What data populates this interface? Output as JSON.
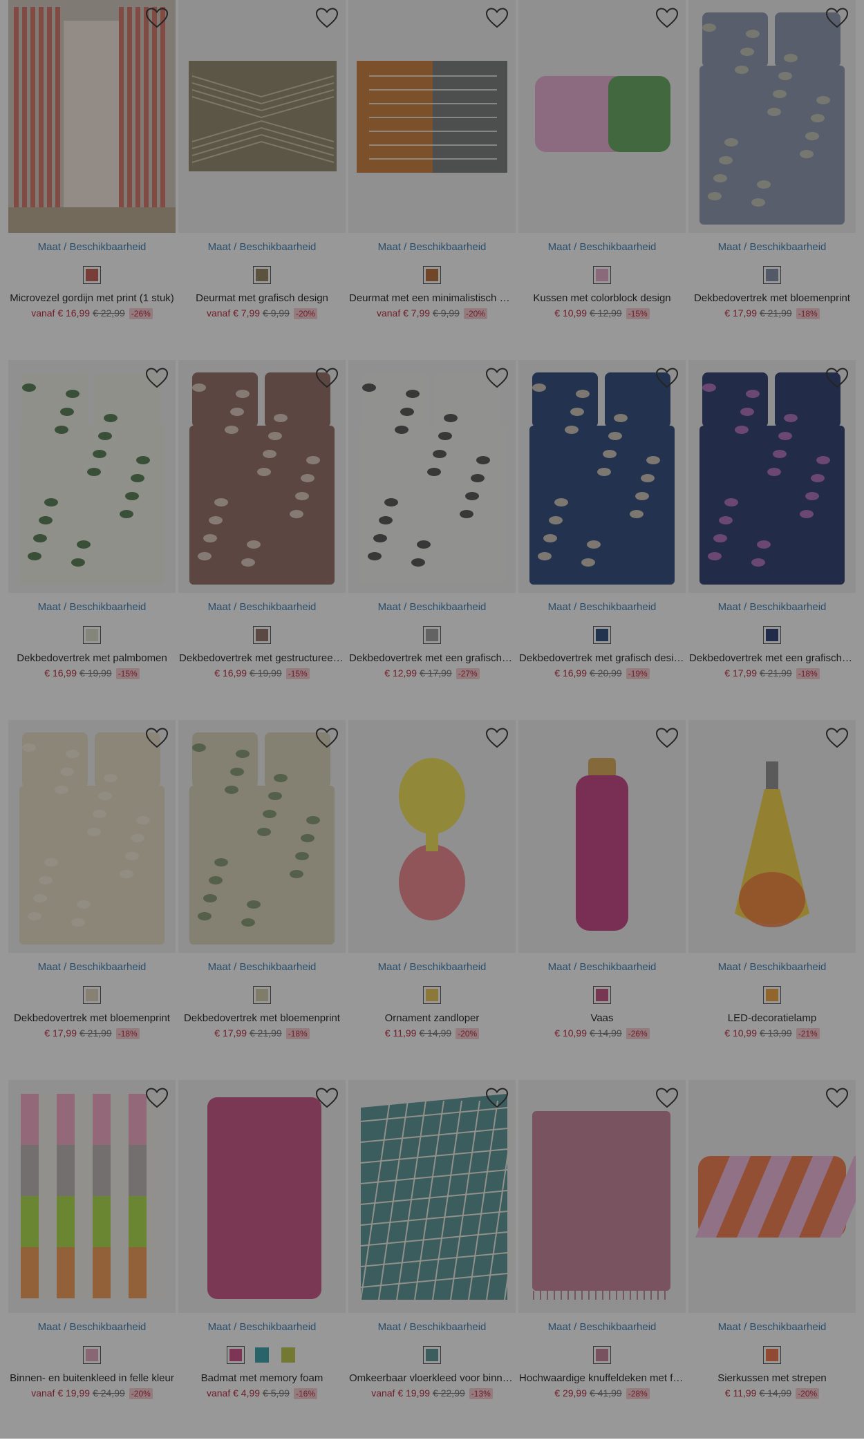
{
  "availability_label": "Maat / Beschikbaarheid",
  "products": [
    {
      "name": "Microvezel gordijn met print (1 stuk)",
      "prefix": "vanaf",
      "price": "€ 16,99",
      "old_price": "€ 22,99",
      "discount": "-26%",
      "image": "curtain",
      "swatches": [
        {
          "color": "#c0514a",
          "selected": true
        }
      ],
      "colors": [
        "#d36a5a",
        "#f3e7dc",
        "#b9a88a"
      ]
    },
    {
      "name": "Deurmat met grafisch design",
      "prefix": "vanaf",
      "price": "€ 7,99",
      "old_price": "€ 9,99",
      "discount": "-20%",
      "image": "mat-zigzag",
      "swatches": [
        {
          "color": "#8a7a55",
          "selected": true
        }
      ],
      "colors": [
        "#8c8163",
        "#c9c0a4"
      ]
    },
    {
      "name": "Deurmat met een minimalistisch design",
      "prefix": "vanaf",
      "price": "€ 7,99",
      "old_price": "€ 9,99",
      "discount": "-20%",
      "image": "mat-split",
      "swatches": [
        {
          "color": "#b0642a",
          "selected": true
        }
      ],
      "colors": [
        "#c7762c",
        "#6f7372",
        "#ffffff"
      ]
    },
    {
      "name": "Kussen met colorblock design",
      "prefix": "",
      "price": "€ 10,99",
      "old_price": "€ 12,99",
      "discount": "-15%",
      "image": "pillow-block",
      "swatches": [
        {
          "color": "#e4a5c8",
          "selected": true
        }
      ],
      "colors": [
        "#e8a7cf",
        "#5aa456"
      ]
    },
    {
      "name": "Dekbedovertrek met bloemenprint",
      "prefix": "",
      "price": "€ 17,99",
      "old_price": "€ 21,99",
      "discount": "-18%",
      "image": "bed",
      "swatches": [
        {
          "color": "#7d86a3",
          "selected": true
        }
      ],
      "colors": [
        "#8790ad",
        "#c9cbb4"
      ]
    },
    {
      "name": "Dekbedovertrek met palmbomen",
      "prefix": "",
      "price": "€ 16,99",
      "old_price": "€ 19,99",
      "discount": "-15%",
      "image": "bed",
      "swatches": [
        {
          "color": "#d9dcc8",
          "selected": true
        }
      ],
      "colors": [
        "#eef0e4",
        "#2f5e2b"
      ]
    },
    {
      "name": "Dekbedovertrek met gestructureerde print",
      "prefix": "",
      "price": "€ 16,99",
      "old_price": "€ 19,99",
      "discount": "-15%",
      "image": "bed",
      "swatches": [
        {
          "color": "#8a6a5e",
          "selected": true
        }
      ],
      "colors": [
        "#8c6358",
        "#ead8cb"
      ]
    },
    {
      "name": "Dekbedovertrek met een grafische print",
      "prefix": "",
      "price": "€ 12,99",
      "old_price": "€ 17,99",
      "discount": "-27%",
      "image": "bed",
      "swatches": [
        {
          "color": "#9a9a9a",
          "selected": true
        }
      ],
      "colors": [
        "#f2f1ed",
        "#2a2a2a"
      ]
    },
    {
      "name": "Dekbedovertrek met grafisch design",
      "prefix": "",
      "price": "€ 16,99",
      "old_price": "€ 20,99",
      "discount": "-19%",
      "image": "bed",
      "swatches": [
        {
          "color": "#1e3f76",
          "selected": true
        }
      ],
      "colors": [
        "#1f3d73",
        "#e9d7bd"
      ]
    },
    {
      "name": "Dekbedovertrek met een grafisch design",
      "prefix": "",
      "price": "€ 17,99",
      "old_price": "€ 21,99",
      "discount": "-18%",
      "image": "bed",
      "swatches": [
        {
          "color": "#1b2f6a",
          "selected": true
        }
      ],
      "colors": [
        "#1d2e66",
        "#c36ec8"
      ]
    },
    {
      "name": "Dekbedovertrek met bloemenprint",
      "prefix": "",
      "price": "€ 17,99",
      "old_price": "€ 21,99",
      "discount": "-18%",
      "image": "bed",
      "swatches": [
        {
          "color": "#ddd3ba",
          "selected": true
        }
      ],
      "colors": [
        "#e6dcc2",
        "#f4ecd8"
      ]
    },
    {
      "name": "Dekbedovertrek met bloemenprint",
      "prefix": "",
      "price": "€ 17,99",
      "old_price": "€ 21,99",
      "discount": "-18%",
      "image": "bed",
      "swatches": [
        {
          "color": "#cfc9a8",
          "selected": true
        }
      ],
      "colors": [
        "#d9d4b7",
        "#6c8a5c"
      ]
    },
    {
      "name": "Ornament zandloper",
      "prefix": "",
      "price": "€ 11,99",
      "old_price": "€ 14,99",
      "discount": "-20%",
      "image": "hourglass",
      "swatches": [
        {
          "color": "#e9c24a",
          "selected": true
        }
      ],
      "colors": [
        "#f1e14a",
        "#f07f86"
      ]
    },
    {
      "name": "Vaas",
      "prefix": "",
      "price": "€ 10,99",
      "old_price": "€ 14,99",
      "discount": "-26%",
      "image": "vase",
      "swatches": [
        {
          "color": "#c0447a",
          "selected": true
        }
      ],
      "colors": [
        "#c4357b",
        "#d9a54b"
      ]
    },
    {
      "name": "LED-decoratielamp",
      "prefix": "",
      "price": "€ 10,99",
      "old_price": "€ 13,99",
      "discount": "-21%",
      "image": "bottle-lamp",
      "swatches": [
        {
          "color": "#f0a030",
          "selected": true
        }
      ],
      "colors": [
        "#f7d23a",
        "#f56a2a"
      ]
    },
    {
      "name": "Binnen- en buitenkleed in felle kleur",
      "prefix": "vanaf",
      "price": "€ 19,99",
      "old_price": "€ 24,99",
      "discount": "-20%",
      "image": "rug-stripes",
      "swatches": [
        {
          "color": "#e0a0b8",
          "selected": true
        }
      ],
      "colors": [
        "#f5a6c4",
        "#b8b0ae",
        "#a9dc3c",
        "#f6964a",
        "#f3efe8"
      ]
    },
    {
      "name": "Badmat met memory foam",
      "prefix": "vanaf",
      "price": "€ 4,99",
      "old_price": "€ 5,99",
      "discount": "-16%",
      "image": "bathmat",
      "swatches": [
        {
          "color": "#c9417f",
          "selected": true
        },
        {
          "color": "#2a9ba8",
          "selected": false
        },
        {
          "color": "#b8c23e",
          "selected": false
        }
      ],
      "colors": [
        "#c5477e"
      ]
    },
    {
      "name": "Omkeerbaar vloerkleed voor binnen en buiten",
      "prefix": "vanaf",
      "price": "€ 19,99",
      "old_price": "€ 22,99",
      "discount": "-13%",
      "image": "rug-grid",
      "swatches": [
        {
          "color": "#4f8f91",
          "selected": true
        }
      ],
      "colors": [
        "#4e8e91",
        "#f2efe6"
      ]
    },
    {
      "name": "Hochwaardige knuffeldeken met franjes",
      "prefix": "",
      "price": "€ 29,99",
      "old_price": "€ 41,99",
      "discount": "-28%",
      "image": "throw",
      "swatches": [
        {
          "color": "#c27a92",
          "selected": true
        }
      ],
      "colors": [
        "#c67b94"
      ]
    },
    {
      "name": "Sierkussen met strepen",
      "prefix": "",
      "price": "€ 11,99",
      "old_price": "€ 14,99",
      "discount": "-20%",
      "image": "pillow-stripes",
      "swatches": [
        {
          "color": "#f06a3a",
          "selected": true
        }
      ],
      "colors": [
        "#f5743e",
        "#f1b4dc"
      ]
    }
  ]
}
